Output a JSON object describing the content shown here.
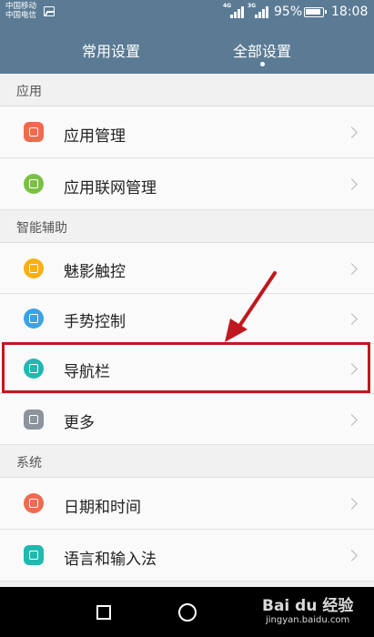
{
  "status_bar": {
    "carrier1": "中国移动",
    "carrier2": "中国电信",
    "net1": "4G",
    "net2": "3G",
    "battery_percent": "95%",
    "battery_level": 0.95,
    "time": "18:08"
  },
  "tabs": {
    "common": "常用设置",
    "all": "全部设置",
    "active": "all"
  },
  "sections": {
    "apps": "应用",
    "assist": "智能辅助",
    "system": "系统"
  },
  "items": [
    {
      "label": "应用管理",
      "icon": "apps-grid-icon",
      "color": "#f06a4f"
    },
    {
      "label": "应用联网管理",
      "icon": "network-sync-icon",
      "color": "#7ac143"
    },
    {
      "label": "魅影触控",
      "icon": "hand-touch-icon",
      "color": "#f6b012"
    },
    {
      "label": "手势控制",
      "icon": "gesture-icon",
      "color": "#3aa2e6"
    },
    {
      "label": "导航栏",
      "icon": "navigation-bar-icon",
      "color": "#21b8b0"
    },
    {
      "label": "更多",
      "icon": "more-dots-icon",
      "color": "#8c939c"
    },
    {
      "label": "日期和时间",
      "icon": "clock-icon",
      "color": "#f06a4f"
    },
    {
      "label": "语言和输入法",
      "icon": "keyboard-icon",
      "color": "#21b8b0"
    }
  ],
  "annotation": {
    "highlight_color": "#c0181f"
  },
  "watermark": {
    "main": "Bai du 经验",
    "sub": "jingyan.baidu.com"
  }
}
